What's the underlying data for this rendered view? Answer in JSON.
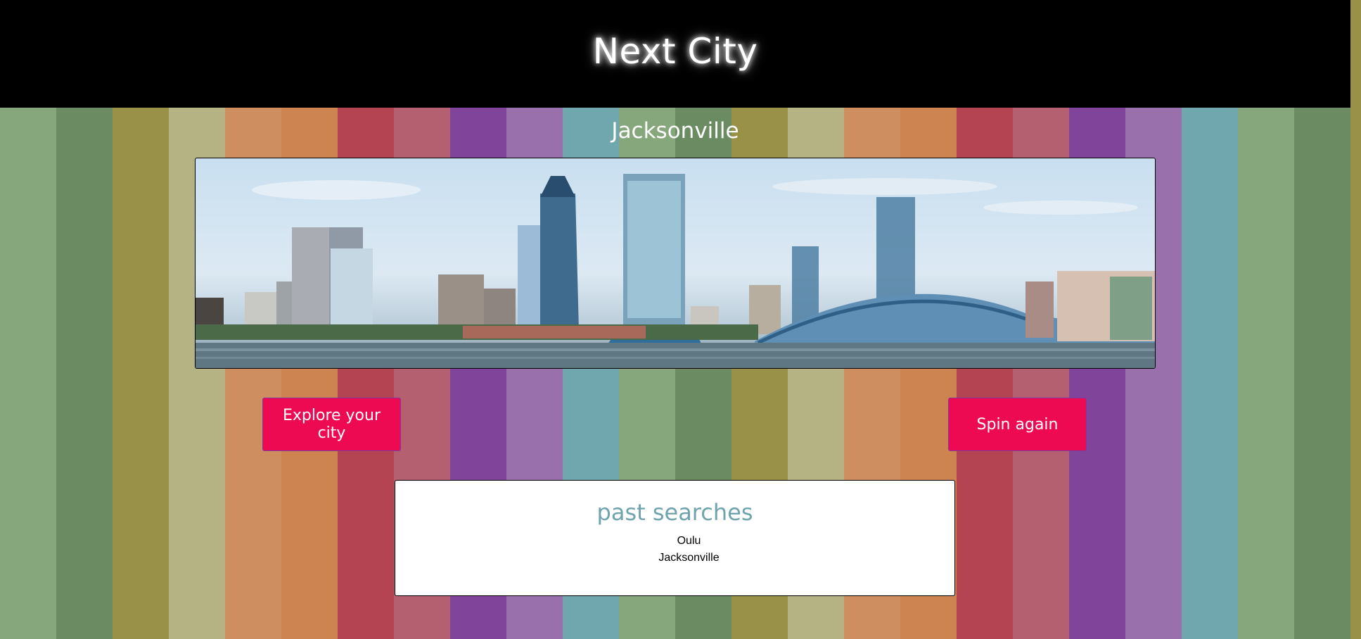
{
  "header": {
    "title": "Next City"
  },
  "city": {
    "name": "Jacksonville",
    "image_alt": "Jacksonville skyline"
  },
  "buttons": {
    "explore_label": "Explore your city",
    "spin_label": "Spin again"
  },
  "past_searches": {
    "heading": "past searches",
    "items": [
      "Oulu",
      "Jacksonville"
    ]
  },
  "colors": {
    "stripes": [
      "#86a67c",
      "#6b8c63",
      "#9a9148",
      "#b5b283",
      "#cf8e60",
      "#ce8450",
      "#b54452",
      "#b46070",
      "#80449a",
      "#9a70ac",
      "#70a6ad"
    ],
    "button": "#ee0a52",
    "heading_accent": "#6fa3ad"
  }
}
